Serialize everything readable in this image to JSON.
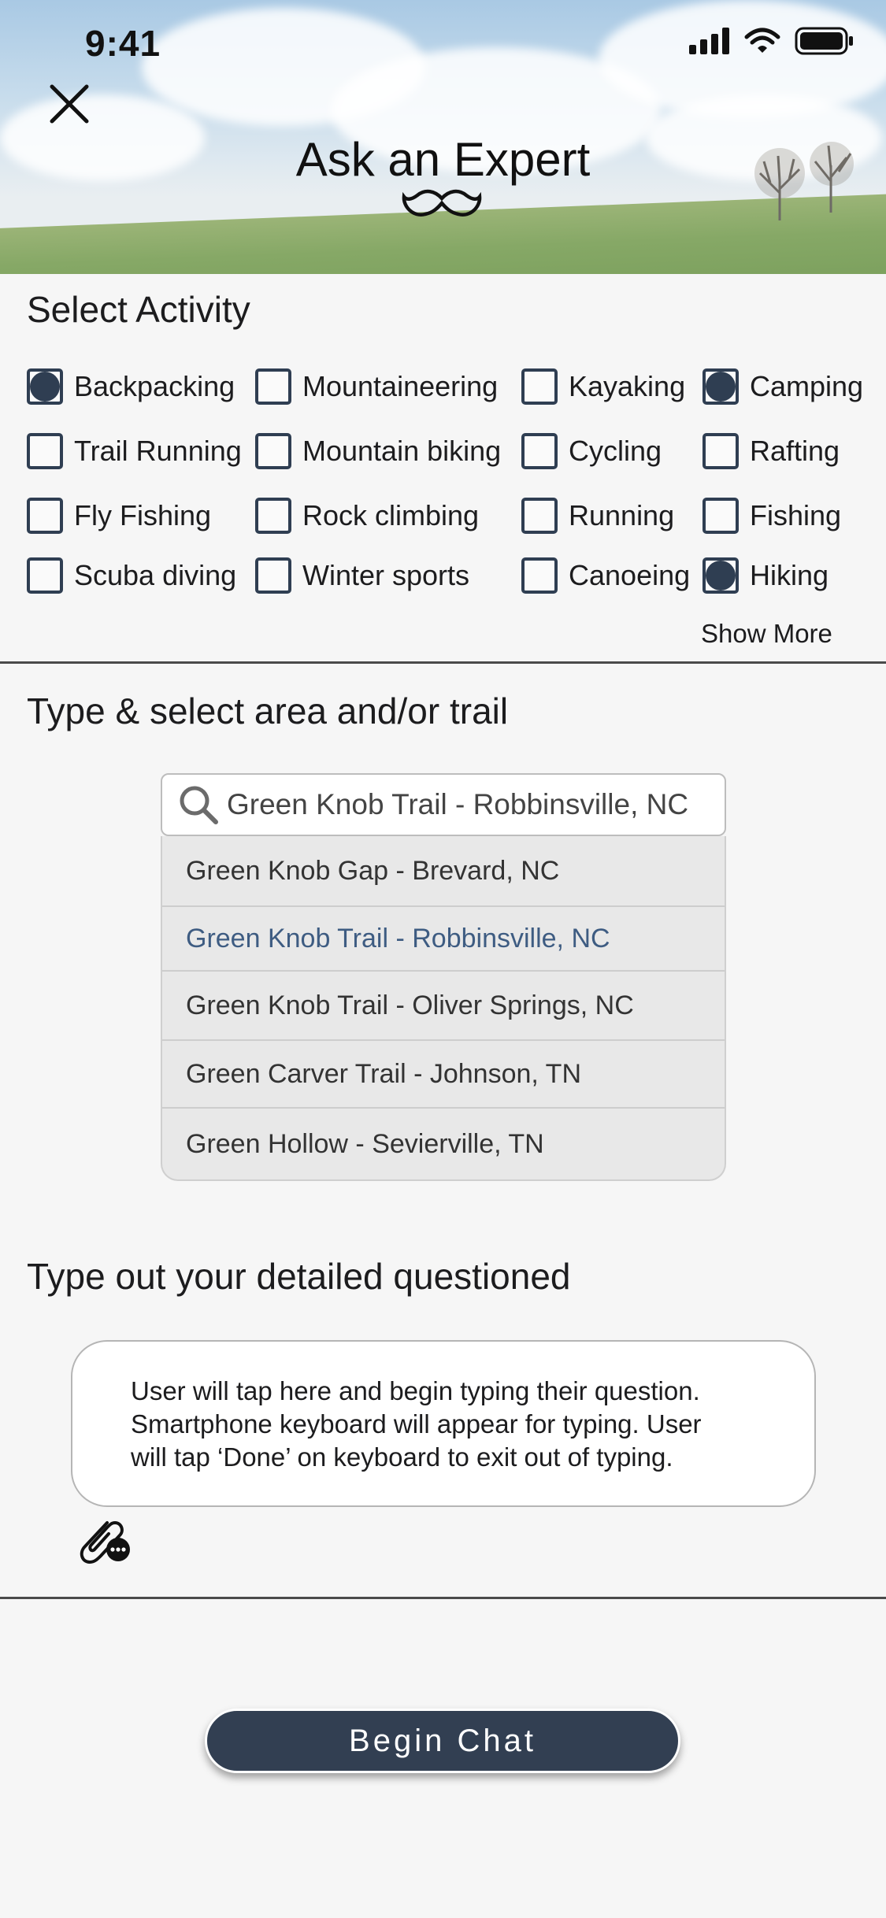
{
  "status_bar": {
    "time": "9:41"
  },
  "header": {
    "title": "Ask an Expert"
  },
  "activity": {
    "title": "Select Activity",
    "options": [
      {
        "label": "Backpacking",
        "checked": true
      },
      {
        "label": "Mountaineering",
        "checked": false
      },
      {
        "label": "Kayaking",
        "checked": false
      },
      {
        "label": "Camping",
        "checked": true
      },
      {
        "label": "Trail Running",
        "checked": false
      },
      {
        "label": "Mountain biking",
        "checked": false
      },
      {
        "label": "Cycling",
        "checked": false
      },
      {
        "label": "Rafting",
        "checked": false
      },
      {
        "label": "Fly Fishing",
        "checked": false
      },
      {
        "label": "Rock climbing",
        "checked": false
      },
      {
        "label": "Running",
        "checked": false
      },
      {
        "label": "Fishing",
        "checked": false
      },
      {
        "label": "Scuba diving",
        "checked": false
      },
      {
        "label": "Winter sports",
        "checked": false
      },
      {
        "label": "Canoeing",
        "checked": false
      },
      {
        "label": "Hiking",
        "checked": true
      }
    ],
    "show_more": "Show More"
  },
  "area": {
    "title": "Type & select area and/or trail",
    "search_value": "Green Knob Trail - Robbinsville, NC",
    "suggestions": [
      "Green Knob Gap - Brevard, NC",
      "Green Knob Trail - Robbinsville, NC",
      "Green Knob Trail - Oliver Springs, NC",
      "Green Carver Trail - Johnson, TN",
      "Green Hollow - Sevierville, TN"
    ],
    "active_suggestion": 1
  },
  "question": {
    "title": "Type out your detailed questioned",
    "lines": [
      "User will tap here and begin typing their question.",
      "Smartphone keyboard will appear for typing. User",
      "will tap ‘Done’ on keyboard to exit out of typing."
    ]
  },
  "begin_chat_label": "Begin Chat",
  "colors": {
    "primary": "#323f52",
    "active_suggestion": "#3e5c82",
    "background": "#f6f6f6"
  },
  "icons": [
    "close-icon",
    "mustache-icon",
    "search-icon",
    "attachment-icon",
    "signal-icon",
    "wifi-icon",
    "battery-icon"
  ]
}
